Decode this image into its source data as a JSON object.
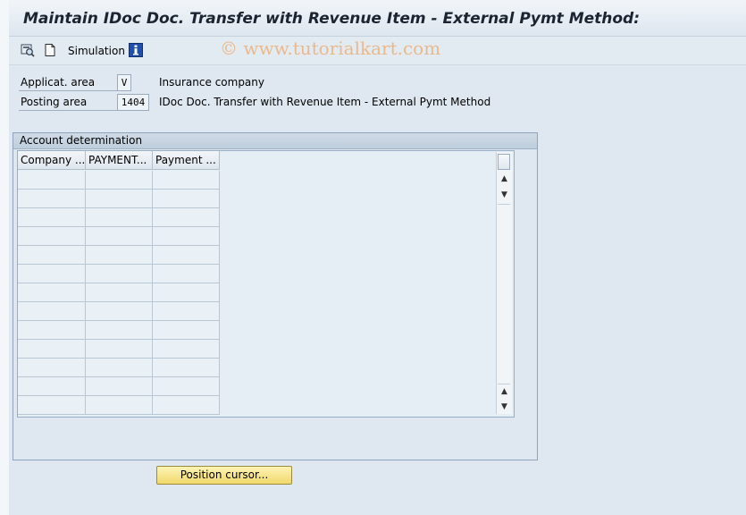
{
  "window": {
    "title": "Maintain IDoc Doc. Transfer with Revenue Item - External Pymt Method:"
  },
  "toolbar": {
    "buttons": [
      {
        "icon": "display-change-icon"
      },
      {
        "icon": "new-document-icon"
      }
    ],
    "simulation_label": "Simulation",
    "info_icon": "info-icon",
    "watermark": "© www.tutorialkart.com"
  },
  "fields": {
    "application_area": {
      "label": "Applicat. area",
      "value": "V",
      "description": "Insurance company"
    },
    "posting_area": {
      "label": "Posting area",
      "value": "1404",
      "description": "IDoc Doc. Transfer with Revenue Item - External Pymt Method"
    }
  },
  "account_determination": {
    "title": "Account determination",
    "columns": [
      "Company ...",
      "PAYMENT...",
      "Payment ..."
    ],
    "rows": [
      [
        "",
        "",
        ""
      ],
      [
        "",
        "",
        ""
      ],
      [
        "",
        "",
        ""
      ],
      [
        "",
        "",
        ""
      ],
      [
        "",
        "",
        ""
      ],
      [
        "",
        "",
        ""
      ],
      [
        "",
        "",
        ""
      ],
      [
        "",
        "",
        ""
      ],
      [
        "",
        "",
        ""
      ],
      [
        "",
        "",
        ""
      ],
      [
        "",
        "",
        ""
      ],
      [
        "",
        "",
        ""
      ],
      [
        "",
        "",
        ""
      ]
    ]
  },
  "actions": {
    "position_cursor_label": "Position cursor..."
  },
  "colors": {
    "background": "#dfe8f0",
    "button_yellow": "#f1d96b",
    "watermark": "#ecaa6e"
  }
}
